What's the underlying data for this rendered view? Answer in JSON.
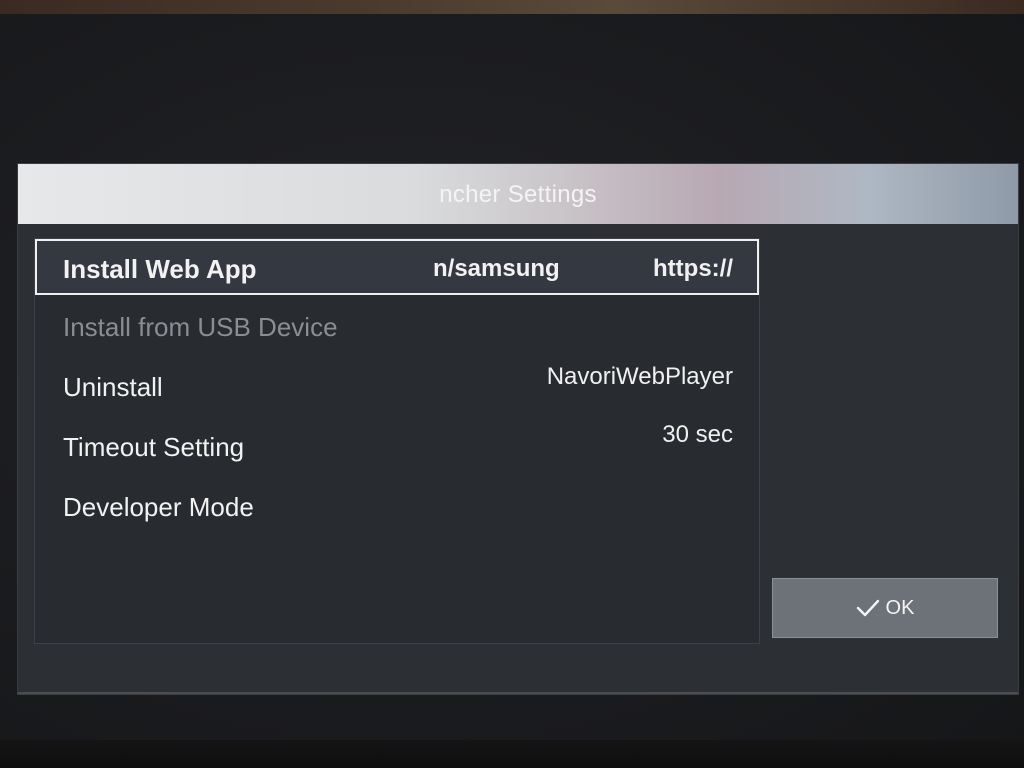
{
  "dialog": {
    "title": "ncher Settings"
  },
  "menu": {
    "items": [
      {
        "label": "Install Web App",
        "mid": "n/samsung",
        "value": "https://"
      },
      {
        "label": "Install from USB Device",
        "mid": "",
        "value": ""
      },
      {
        "label": "Uninstall",
        "mid": "",
        "value": "NavoriWebPlayer"
      },
      {
        "label": "Timeout Setting",
        "mid": "",
        "value": "30 sec"
      },
      {
        "label": "Developer Mode",
        "mid": "",
        "value": ""
      }
    ]
  },
  "buttons": {
    "ok_label": "OK"
  },
  "colors": {
    "selection_border": "#f0f0f0",
    "disabled_text": "#8a8d92",
    "ok_button_bg": "#6c7278"
  }
}
